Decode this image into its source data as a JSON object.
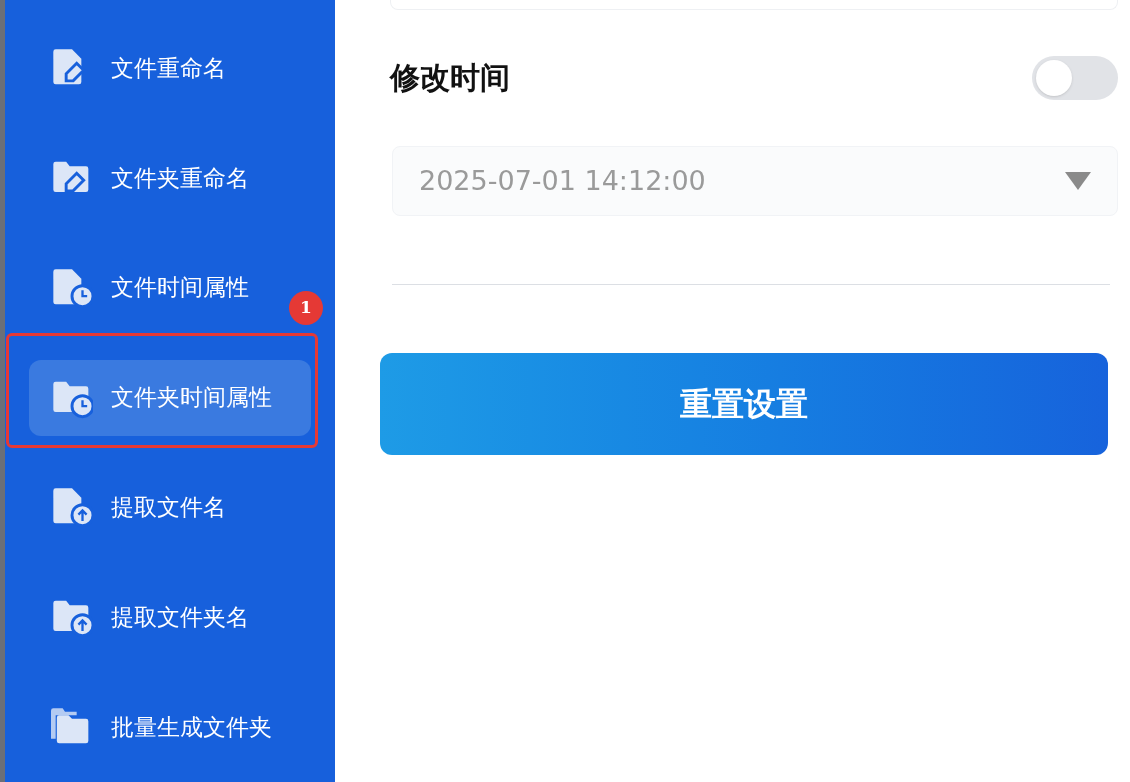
{
  "sidebar": {
    "items": [
      {
        "label": "文件重命名",
        "selected": false
      },
      {
        "label": "文件夹重命名",
        "selected": false
      },
      {
        "label": "文件时间属性",
        "selected": false
      },
      {
        "label": "文件夹时间属性",
        "selected": true,
        "callout": "1"
      },
      {
        "label": "提取文件名",
        "selected": false
      },
      {
        "label": "提取文件夹名",
        "selected": false
      },
      {
        "label": "批量生成文件夹",
        "selected": false
      }
    ]
  },
  "modify_time": {
    "label": "修改时间",
    "on": false,
    "value": "2025-07-01 14:12:00"
  },
  "reset_button": "重置设置"
}
